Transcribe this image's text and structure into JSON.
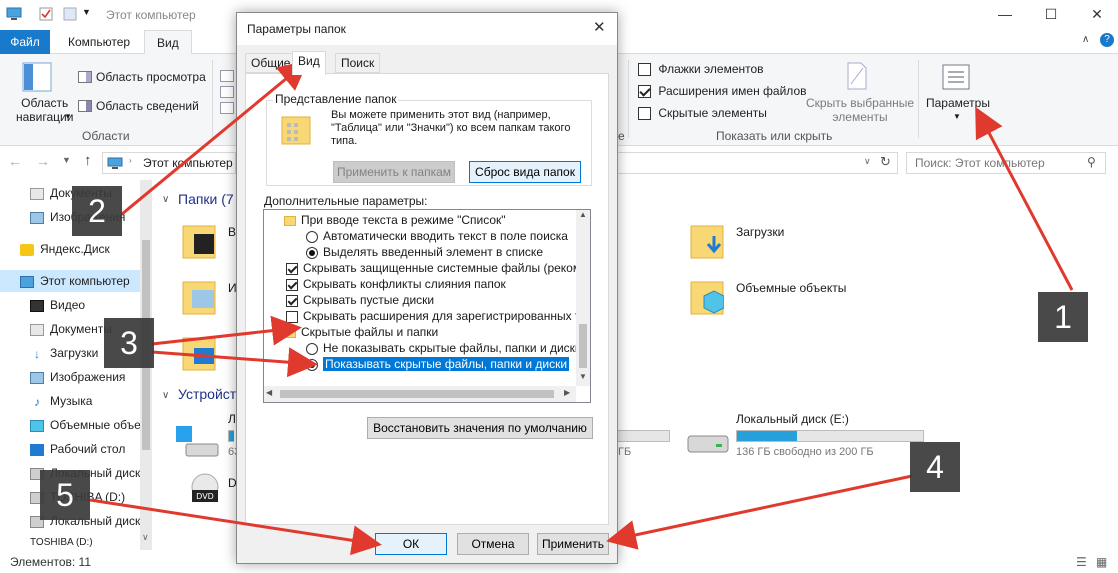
{
  "window": {
    "title": "Этот компьютер",
    "controls": [
      "—",
      "☐",
      "✕"
    ]
  },
  "ribbon": {
    "tabs": [
      "Файл",
      "Компьютер",
      "Вид"
    ],
    "panes": {
      "nav_pane_label": "Область\nнавигации",
      "preview_pane": "Область просмотра",
      "details_pane": "Область сведений",
      "group_label": "Области"
    },
    "show_hide": {
      "item_checkboxes": "Флажки элементов",
      "file_extensions": "Расширения имен файлов",
      "hidden_items": "Скрытые элементы",
      "hide_selected": "Скрыть выбранные\nэлементы",
      "group_label": "Показать или скрыть",
      "group_label_partial": "е"
    },
    "options": "Параметры"
  },
  "address": {
    "path": "Этот компьютер",
    "search_placeholder": "Поиск: Этот компьютер"
  },
  "nav": {
    "items": [
      {
        "label": "Документы",
        "icon": "documents-icon"
      },
      {
        "label": "Изображения",
        "icon": "pictures-icon"
      },
      {
        "label": "Яндекс.Диск",
        "icon": "yandex-disk-icon"
      },
      {
        "label": "Этот компьютер",
        "icon": "computer-icon"
      },
      {
        "label": "Видео",
        "icon": "video-icon"
      },
      {
        "label": "Документы",
        "icon": "documents-icon"
      },
      {
        "label": "Загрузки",
        "icon": "downloads-icon"
      },
      {
        "label": "Изображения",
        "icon": "pictures-icon"
      },
      {
        "label": "Музыка",
        "icon": "music-icon"
      },
      {
        "label": "Объемные объекты",
        "icon": "3d-objects-icon"
      },
      {
        "label": "Рабочий стол",
        "icon": "desktop-icon"
      },
      {
        "label": "Локальный диск",
        "icon": "drive-icon"
      },
      {
        "label": "TOSHIBA (D:)",
        "icon": "drive-icon"
      },
      {
        "label": "Локальный диск",
        "icon": "drive-icon"
      },
      {
        "label": "TOSHIBA (D:)",
        "icon": "drive-icon"
      }
    ]
  },
  "content": {
    "folders_header": "Папки (7",
    "devices_header": "Устройст",
    "folders_right": [
      {
        "label": "Загрузки",
        "icon": "downloads-folder-icon"
      },
      {
        "label": "Объемные объекты",
        "icon": "3d-objects-folder-icon"
      }
    ],
    "folder_left_partial": [
      "В",
      "И"
    ],
    "drive_left": {
      "label": "Л",
      "size": "63"
    },
    "dvd_left": {
      "label": "D"
    },
    "drive_partial_text": "ГБ",
    "drive_e": {
      "label": "Локальный диск (E:)",
      "free": "136 ГБ свободно из 200 ГБ",
      "used_fraction": 0.32
    }
  },
  "status": {
    "items_count": "Элементов: 11"
  },
  "dialog": {
    "title": "Параметры папок",
    "tabs": [
      "Общие",
      "Вид",
      "Поиск"
    ],
    "folder_views": {
      "group_title": "Представление папок",
      "description": "Вы можете применить этот вид (например, \"Таблица\" или \"Значки\") ко всем папкам такого типа.",
      "apply_button": "Применить к папкам",
      "reset_button": "Сброс вида папок"
    },
    "advanced_label": "Дополнительные параметры:",
    "tree": [
      {
        "kind": "folder",
        "label": "При вводе текста в режиме \"Список\"",
        "indent": 0
      },
      {
        "kind": "radio",
        "checked": false,
        "label": "Автоматически вводить текст в поле поиска",
        "indent": 1
      },
      {
        "kind": "radio",
        "checked": true,
        "label": "Выделять введенный элемент в списке",
        "indent": 1
      },
      {
        "kind": "checkbox",
        "checked": true,
        "label": "Скрывать защищенные системные файлы (рекомен",
        "indent": 0
      },
      {
        "kind": "checkbox",
        "checked": true,
        "label": "Скрывать конфликты слияния папок",
        "indent": 0
      },
      {
        "kind": "checkbox",
        "checked": true,
        "label": "Скрывать пустые диски",
        "indent": 0
      },
      {
        "kind": "checkbox",
        "checked": false,
        "label": "Скрывать расширения для зарегистрированных типо",
        "indent": 0
      },
      {
        "kind": "folder",
        "label": "Скрытые файлы и папки",
        "indent": 0
      },
      {
        "kind": "radio",
        "checked": false,
        "label": "Не показывать скрытые файлы, папки и диски",
        "indent": 1
      },
      {
        "kind": "radio",
        "checked": true,
        "label": "Показывать скрытые файлы, папки и диски",
        "indent": 1,
        "selected": true
      }
    ],
    "restore_defaults": "Восстановить значения по умолчанию",
    "ok": "ОК",
    "cancel": "Отмена",
    "apply": "Применить"
  },
  "callouts": [
    "1",
    "2",
    "3",
    "4",
    "5"
  ],
  "colors": {
    "accent": "#1979ca",
    "arrow": "#e03a2f",
    "selection": "#0078d7",
    "callout_bg": "#3a3a3a"
  }
}
